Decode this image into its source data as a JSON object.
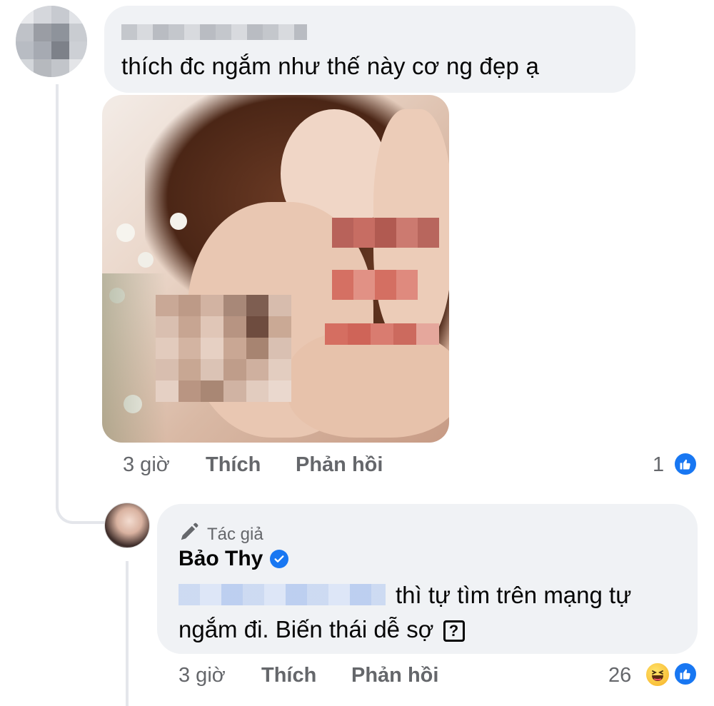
{
  "comment": {
    "text": "thích đc ngắm như thế này cơ ng đẹp ạ",
    "time": "3 giờ",
    "like_label": "Thích",
    "reply_label": "Phản hồi",
    "reaction_count": "1"
  },
  "reply": {
    "author_badge": "Tác giả",
    "author_name": "Bảo Thy",
    "text": "thì tự tìm trên mạng tự ngắm đi. Biến thái dễ sợ",
    "question_glyph": "?",
    "time": "3 giờ",
    "like_label": "Thích",
    "reply_label": "Phản hồi",
    "reaction_count": "26"
  },
  "colors": {
    "bubble_bg": "#f0f2f5",
    "meta_text": "#65676b",
    "facebook_blue": "#1877f2",
    "haha_yellow": "#f7b125"
  },
  "icons": {
    "like": "thumbs-up-icon",
    "haha": "laughing-face-icon",
    "author": "pen-icon",
    "verified": "check-badge-icon"
  }
}
